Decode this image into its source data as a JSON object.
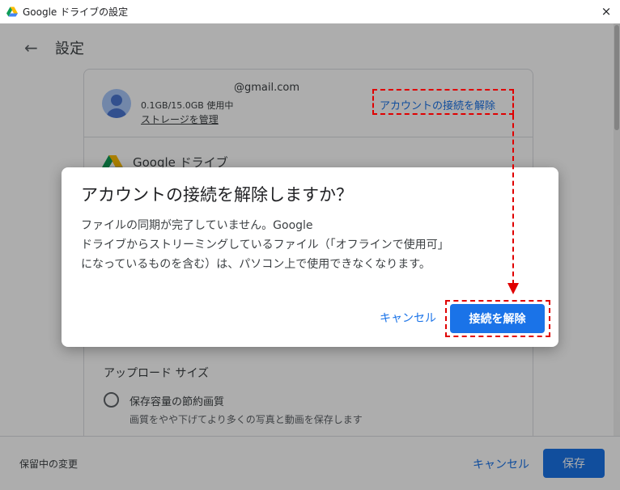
{
  "window": {
    "title": "Google ドライブの設定",
    "close_icon": "×"
  },
  "page": {
    "title": "設定",
    "back_icon": "←"
  },
  "account": {
    "email": "@gmail.com",
    "storage_usage": "0.1GB/15.0GB 使用中",
    "manage_storage": "ストレージを管理",
    "disconnect_link": "アカウントの接続を解除"
  },
  "drive_section": {
    "title": "Google ドライブ"
  },
  "upload": {
    "heading": "アップロード サイズ",
    "option_label": "保存容量の節約画質",
    "option_desc": "画質をやや下げてより多くの写真と動画を保存します"
  },
  "footer": {
    "pending": "保留中の変更",
    "cancel": "キャンセル",
    "save": "保存"
  },
  "dialog": {
    "title": "アカウントの接続を解除しますか？",
    "body_line1": "ファイルの同期が完了していません。Google",
    "body_line2": "ドライブからストリーミングしているファイル（「オフラインで使用可」",
    "body_line3": "になっているものを含む）は、パソコン上で使用できなくなります。",
    "cancel": "キャンセル",
    "confirm": "接続を解除"
  },
  "colors": {
    "accent": "#1a73e8",
    "annotation": "#e00000"
  }
}
